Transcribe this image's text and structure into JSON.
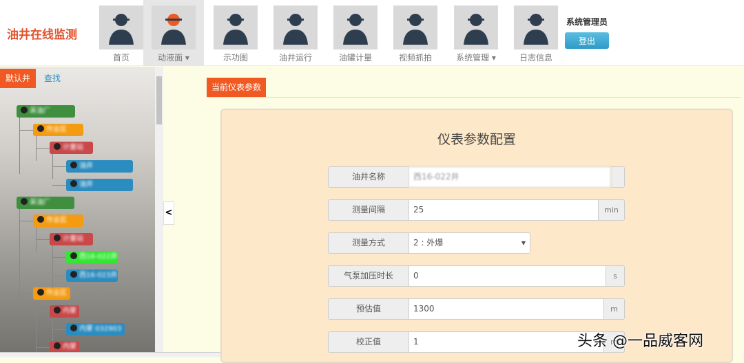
{
  "header": {
    "logo": "油井在线监测",
    "admin": "系统管理员",
    "logout": "登出",
    "nav": [
      {
        "label": "首页",
        "icon": "worker-icon"
      },
      {
        "label": "动液面 ▾",
        "icon": "monitor-chart-icon"
      },
      {
        "label": "示功图",
        "icon": "crane-icon"
      },
      {
        "label": "油井运行",
        "icon": "operation-screen-icon"
      },
      {
        "label": "油罐计量",
        "icon": "tower-crane-icon"
      },
      {
        "label": "视频抓拍",
        "icon": "desk-worker-icon"
      },
      {
        "label": "系统管理 ▾",
        "icon": "gears-icon"
      },
      {
        "label": "日志信息",
        "icon": "reading-worker-icon"
      }
    ]
  },
  "sidebar": {
    "tab_default": "默认井",
    "tab_search": "查找",
    "tree": [
      {
        "label": "采油厂",
        "color": "#3f8f3f"
      },
      {
        "label": "作业区",
        "color": "#f39c12"
      },
      {
        "label": "计量站",
        "color": "#c9484a"
      },
      {
        "label": "油井",
        "color": "#2b8cbf"
      },
      {
        "label": "油井",
        "color": "#2b8cbf"
      },
      {
        "label": "采油厂",
        "color": "#3f8f3f"
      },
      {
        "label": "作业区",
        "color": "#f39c12"
      },
      {
        "label": "计量站",
        "color": "#c9484a"
      },
      {
        "label": "西16-022井",
        "color": "#33e633"
      },
      {
        "label": "西16-023井",
        "color": "#2b8cbf"
      },
      {
        "label": "作业区",
        "color": "#f39c12"
      },
      {
        "label": "内蒙",
        "color": "#c9484a"
      },
      {
        "label": "内蒙 032903",
        "color": "#2b8cbf"
      },
      {
        "label": "内蒙",
        "color": "#c9484a"
      }
    ]
  },
  "main": {
    "tab": "当前仪表参数",
    "title": "仪表参数配置",
    "fields": [
      {
        "label": "油井名称",
        "value": "西16-022井",
        "unit": ""
      },
      {
        "label": "测量间隔",
        "value": "25",
        "unit": "min"
      },
      {
        "label": "测量方式",
        "value": "2 : 外爆",
        "unit": ""
      },
      {
        "label": "气泵加压时长",
        "value": "0",
        "unit": "s"
      },
      {
        "label": "预估值",
        "value": "1300",
        "unit": "m"
      },
      {
        "label": "校正值",
        "value": "1",
        "unit": "m"
      }
    ]
  },
  "watermark": "头条 @一品威客网"
}
